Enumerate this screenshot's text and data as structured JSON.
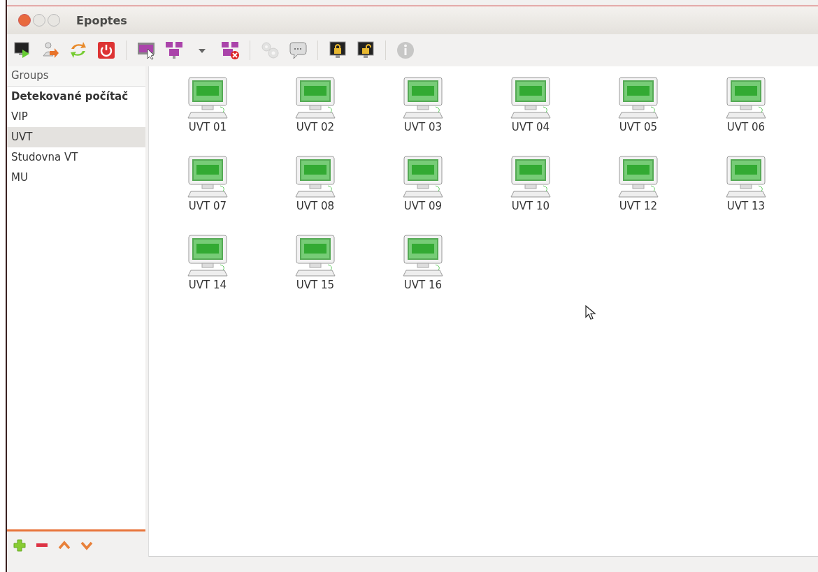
{
  "window": {
    "title": "Epoptes"
  },
  "toolbar": [
    {
      "kind": "remote",
      "disabled": false
    },
    {
      "kind": "user",
      "disabled": false
    },
    {
      "kind": "refresh",
      "disabled": false
    },
    {
      "kind": "power",
      "disabled": false
    },
    {
      "kind": "sep"
    },
    {
      "kind": "broadcast",
      "disabled": false
    },
    {
      "kind": "broadcast-multi",
      "disabled": false
    },
    {
      "kind": "dropdown",
      "disabled": false
    },
    {
      "kind": "broadcast-stop",
      "disabled": false
    },
    {
      "kind": "sep"
    },
    {
      "kind": "gears",
      "disabled": true
    },
    {
      "kind": "message",
      "disabled": false
    },
    {
      "kind": "sep"
    },
    {
      "kind": "lock",
      "disabled": false
    },
    {
      "kind": "unlock",
      "disabled": false
    },
    {
      "kind": "sep"
    },
    {
      "kind": "info",
      "disabled": true
    }
  ],
  "sidebar": {
    "header": "Groups",
    "items": [
      {
        "label": "Detekované počítač",
        "bold": true,
        "selected": false
      },
      {
        "label": "VIP",
        "bold": false,
        "selected": false
      },
      {
        "label": "UVT",
        "bold": false,
        "selected": true
      },
      {
        "label": "Studovna VT",
        "bold": false,
        "selected": false
      },
      {
        "label": "MU",
        "bold": false,
        "selected": false
      }
    ],
    "buttons": [
      {
        "kind": "add"
      },
      {
        "kind": "remove"
      },
      {
        "kind": "up"
      },
      {
        "kind": "down"
      }
    ]
  },
  "clients": [
    {
      "name": "UVT 01"
    },
    {
      "name": "UVT 02"
    },
    {
      "name": "UVT 03"
    },
    {
      "name": "UVT 04"
    },
    {
      "name": "UVT 05"
    },
    {
      "name": "UVT 06"
    },
    {
      "name": "UVT 07"
    },
    {
      "name": "UVT 08"
    },
    {
      "name": "UVT 09"
    },
    {
      "name": "UVT 10"
    },
    {
      "name": "UVT 12"
    },
    {
      "name": "UVT 13"
    },
    {
      "name": "UVT 14"
    },
    {
      "name": "UVT 15"
    },
    {
      "name": "UVT 16"
    }
  ]
}
